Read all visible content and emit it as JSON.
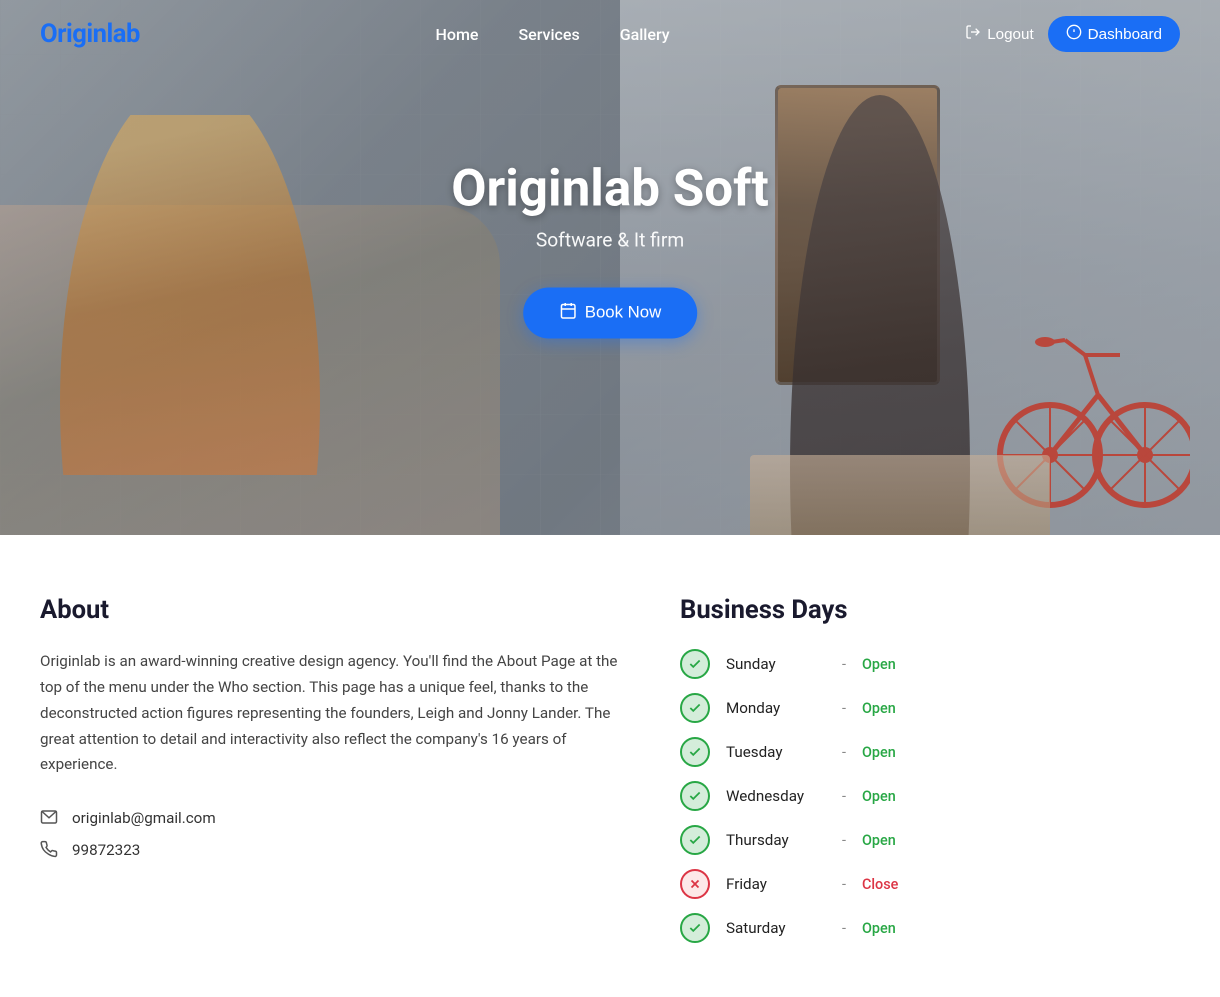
{
  "nav": {
    "logo": "Originlab",
    "links": [
      {
        "label": "Home",
        "href": "#"
      },
      {
        "label": "Services",
        "href": "#"
      },
      {
        "label": "Gallery",
        "href": "#"
      }
    ],
    "logout_label": "Logout",
    "dashboard_label": "Dashboard"
  },
  "hero": {
    "title": "Originlab Soft",
    "subtitle": "Software & It firm",
    "book_now": "Book Now"
  },
  "about": {
    "title": "About",
    "body": "Originlab is an award-winning creative design agency. You'll find the About Page at the top of the menu under the Who section. This page has a unique feel, thanks to the deconstructed action figures representing the founders, Leigh and Jonny Lander. The great attention to detail and interactivity also reflect the company's 16 years of experience.",
    "email": "originlab@gmail.com",
    "phone": "99872323"
  },
  "business_days": {
    "title": "Business Days",
    "days": [
      {
        "name": "Sunday",
        "status": "Open",
        "is_open": true
      },
      {
        "name": "Monday",
        "status": "Open",
        "is_open": true
      },
      {
        "name": "Tuesday",
        "status": "Open",
        "is_open": true
      },
      {
        "name": "Wednesday",
        "status": "Open",
        "is_open": true
      },
      {
        "name": "Thursday",
        "status": "Open",
        "is_open": true
      },
      {
        "name": "Friday",
        "status": "Close",
        "is_open": false
      },
      {
        "name": "Saturday",
        "status": "Open",
        "is_open": true
      }
    ]
  },
  "colors": {
    "brand_blue": "#1a6ef5",
    "open_green": "#28a745",
    "close_red": "#dc3545"
  }
}
